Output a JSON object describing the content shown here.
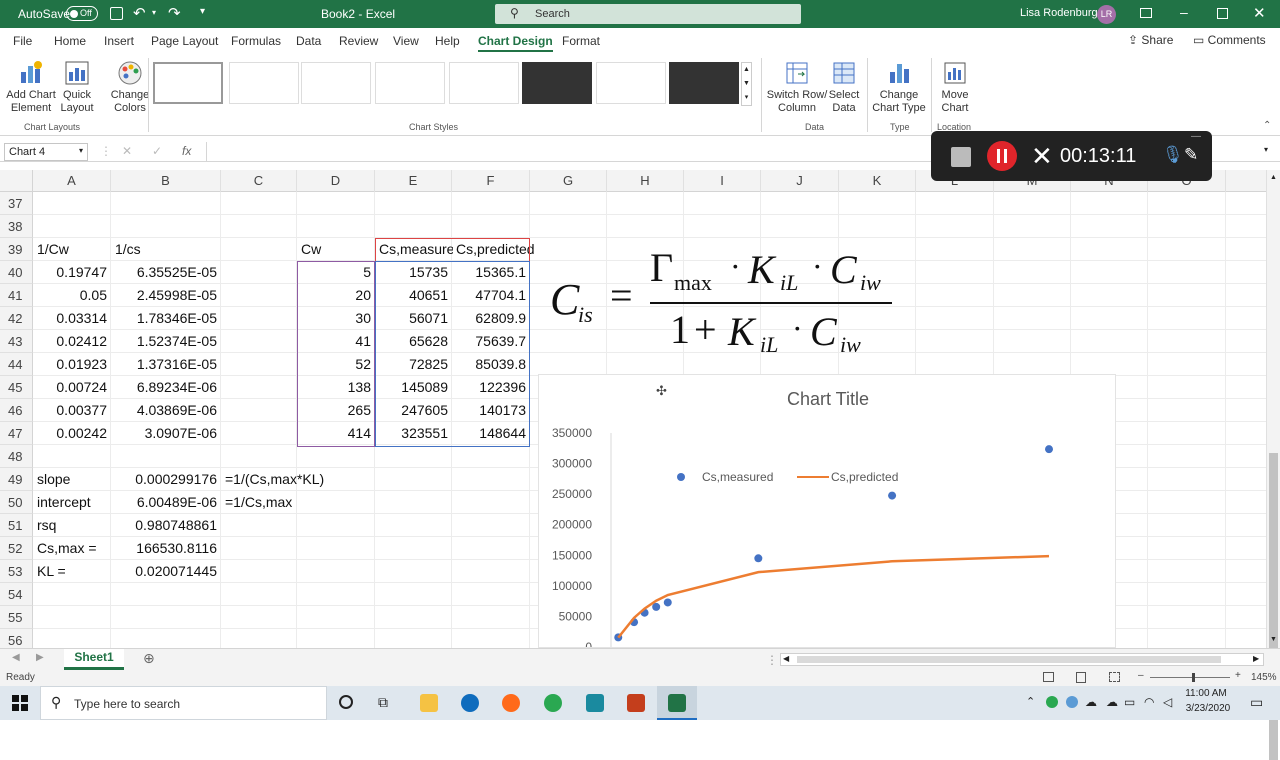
{
  "title_bar": {
    "autosave_label": "AutoSave",
    "autosave_state": "Off",
    "doc_title": "Book2 - Excel",
    "search_placeholder": "Search",
    "user_name": "Lisa Rodenburg",
    "user_initials": "LR"
  },
  "menu_tabs": [
    "File",
    "Home",
    "Insert",
    "Page Layout",
    "Formulas",
    "Data",
    "Review",
    "View",
    "Help",
    "Chart Design",
    "Format"
  ],
  "active_tab": "Chart Design",
  "share_label": "Share",
  "comments_label": "Comments",
  "ribbon": {
    "add_chart_element": "Add Chart Element",
    "quick_layout": "Quick Layout",
    "change_colors": "Change Colors",
    "chart_layouts_group": "Chart Layouts",
    "chart_styles_group": "Chart Styles",
    "switch_row_column": "Switch Row/ Column",
    "select_data": "Select Data",
    "data_group": "Data",
    "change_chart_type": "Change Chart Type",
    "type_group": "Type",
    "move_chart": "Move Chart",
    "location_group": "Location"
  },
  "name_box": "Chart 4",
  "fx_label": "fx",
  "recorder": {
    "timer": "00:13:11"
  },
  "columns": [
    "A",
    "B",
    "C",
    "D",
    "E",
    "F",
    "G",
    "H",
    "I",
    "J",
    "K",
    "L",
    "M",
    "N",
    "O"
  ],
  "rows": [
    "37",
    "38",
    "39",
    "40",
    "41",
    "42",
    "43",
    "44",
    "45",
    "46",
    "47",
    "48",
    "49",
    "50",
    "51",
    "52",
    "53",
    "54",
    "55",
    "56"
  ],
  "cells": {
    "header": {
      "a": "1/Cw",
      "b": "1/cs",
      "d": "Cw",
      "e": "Cs,measured",
      "f": "Cs,predicted"
    },
    "data_rows": [
      {
        "a": "0.19747",
        "b": "6.35525E-05",
        "d": "5",
        "e": "15735",
        "f": "15365.1"
      },
      {
        "a": "0.05",
        "b": "2.45998E-05",
        "d": "20",
        "e": "40651",
        "f": "47704.1"
      },
      {
        "a": "0.03314",
        "b": "1.78346E-05",
        "d": "30",
        "e": "56071",
        "f": "62809.9"
      },
      {
        "a": "0.02412",
        "b": "1.52374E-05",
        "d": "41",
        "e": "65628",
        "f": "75639.7"
      },
      {
        "a": "0.01923",
        "b": "1.37316E-05",
        "d": "52",
        "e": "72825",
        "f": "85039.8"
      },
      {
        "a": "0.00724",
        "b": "6.89234E-06",
        "d": "138",
        "e": "145089",
        "f": "122396"
      },
      {
        "a": "0.00377",
        "b": "4.03869E-06",
        "d": "265",
        "e": "247605",
        "f": "140173"
      },
      {
        "a": "0.00242",
        "b": "3.0907E-06",
        "d": "414",
        "e": "323551",
        "f": "148644"
      }
    ],
    "stats": [
      {
        "a": "slope",
        "b": "0.000299176",
        "c": "=1/(Cs,max*KL)"
      },
      {
        "a": "intercept",
        "b": "6.00489E-06",
        "c": "=1/Cs,max"
      },
      {
        "a": "rsq",
        "b": "0.980748861",
        "c": ""
      },
      {
        "a": "Cs,max =",
        "b": "166530.8116",
        "c": ""
      },
      {
        "a": "KL =",
        "b": "0.020071445",
        "c": ""
      }
    ]
  },
  "equation": {
    "lhs": "C",
    "lhs_sub": "is",
    "eq": "=",
    "num_gamma": "Γ",
    "num_gamma_sub": "max",
    "num_k": "K",
    "num_k_sub": "iL",
    "num_c": "C",
    "num_c_sub": "iw",
    "den_one": "1",
    "den_plus": "+",
    "den_k": "K",
    "den_k_sub": "iL",
    "den_c": "C",
    "den_c_sub": "iw",
    "dot": "·"
  },
  "chart_data": {
    "type": "scatter",
    "title": "Chart Title",
    "series": [
      {
        "name": "Cs,measured",
        "kind": "scatter",
        "color": "#4472c4",
        "x": [
          5,
          20,
          30,
          41,
          52,
          138,
          265,
          414
        ],
        "y": [
          15735,
          40651,
          56071,
          65628,
          72825,
          145089,
          247605,
          323551
        ]
      },
      {
        "name": "Cs,predicted",
        "kind": "line",
        "color": "#ed7d31",
        "x": [
          5,
          20,
          30,
          41,
          52,
          138,
          265,
          414
        ],
        "y": [
          15365.1,
          47704.1,
          62809.9,
          75639.7,
          85039.8,
          122396,
          140173,
          148644
        ]
      }
    ],
    "y_ticks": [
      "350000",
      "300000",
      "250000",
      "200000",
      "150000",
      "100000",
      "50000",
      "0"
    ],
    "ylim": [
      0,
      350000
    ],
    "xlim": [
      0,
      414
    ],
    "legend_position": "top-left-inside"
  },
  "sheet_tab": "Sheet1",
  "status": {
    "ready": "Ready",
    "zoom": "145%"
  },
  "taskbar": {
    "search_placeholder": "Type here to search",
    "time": "11:00 AM",
    "date": "3/23/2020"
  }
}
